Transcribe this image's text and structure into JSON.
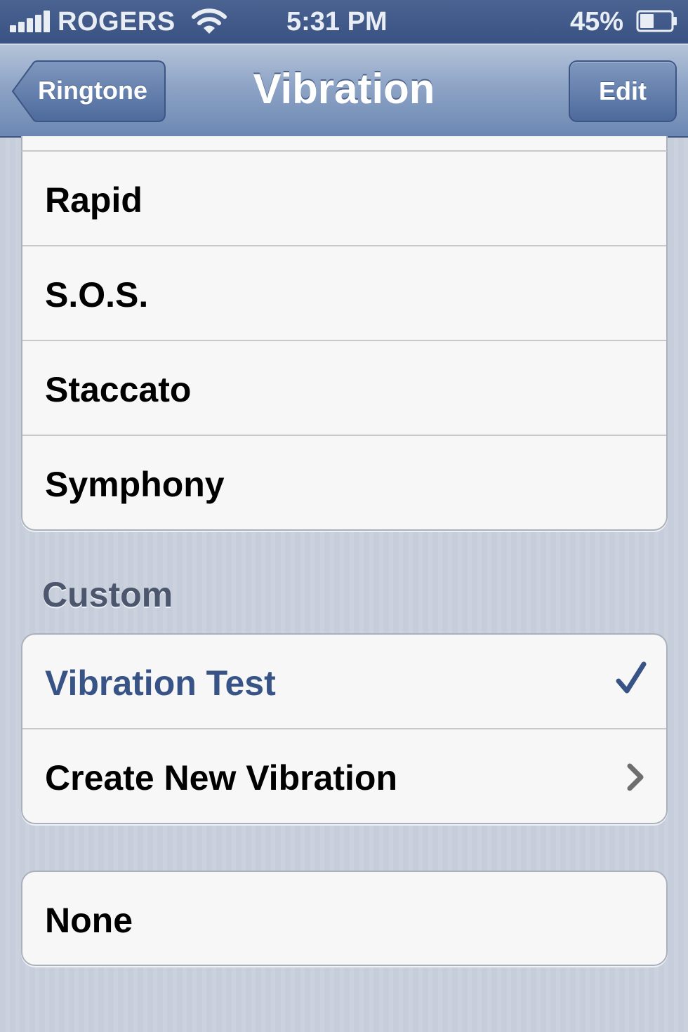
{
  "status_bar": {
    "carrier": "ROGERS",
    "time": "5:31 PM",
    "battery_percent": "45%",
    "battery_level": 0.45,
    "signal_bars": 5,
    "icons": [
      "signal-icon",
      "wifi-icon",
      "battery-icon"
    ]
  },
  "nav": {
    "back_label": "Ringtone",
    "title": "Vibration",
    "edit_label": "Edit"
  },
  "standard_group": {
    "items": [
      {
        "label": "Rapid"
      },
      {
        "label": "S.O.S."
      },
      {
        "label": "Staccato"
      },
      {
        "label": "Symphony"
      }
    ]
  },
  "custom_group": {
    "header": "Custom",
    "items": [
      {
        "label": "Vibration Test",
        "selected": true,
        "accessory": "checkmark-icon"
      },
      {
        "label": "Create New Vibration",
        "accessory": "chevron-right-icon"
      }
    ]
  },
  "none_group": {
    "items": [
      {
        "label": "None"
      }
    ]
  },
  "colors": {
    "selected_text": "#385487",
    "nav_bar": "#6c88b2",
    "status_bar": "#3a5283"
  }
}
